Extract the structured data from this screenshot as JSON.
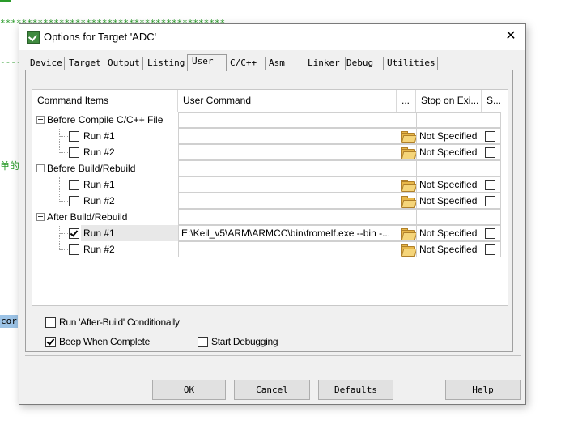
{
  "background": {
    "stars": "******************************************",
    "dashes": "-------",
    "cn_text": "单的",
    "highlight_text": "cor"
  },
  "dialog": {
    "title": "Options for Target 'ADC'",
    "close_glyph": "✕"
  },
  "tabs": [
    {
      "label": "Device"
    },
    {
      "label": "Target"
    },
    {
      "label": "Output"
    },
    {
      "label": "Listing"
    },
    {
      "label": "User"
    },
    {
      "label": "C/C++"
    },
    {
      "label": "Asm"
    },
    {
      "label": "Linker"
    },
    {
      "label": "Debug"
    },
    {
      "label": "Utilities"
    }
  ],
  "active_tab": "User",
  "grid": {
    "headers": {
      "command_items": "Command Items",
      "user_command": "User Command",
      "browse": "...",
      "stop_on_exit": "Stop on Exi...",
      "s": "S..."
    },
    "groups": [
      {
        "label": "Before Compile C/C++ File",
        "runs": [
          {
            "label": "Run #1",
            "checked": false,
            "command": "",
            "stop": "Not Specified",
            "s_checked": false
          },
          {
            "label": "Run #2",
            "checked": false,
            "command": "",
            "stop": "Not Specified",
            "s_checked": false
          }
        ]
      },
      {
        "label": "Before Build/Rebuild",
        "runs": [
          {
            "label": "Run #1",
            "checked": false,
            "command": "",
            "stop": "Not Specified",
            "s_checked": false
          },
          {
            "label": "Run #2",
            "checked": false,
            "command": "",
            "stop": "Not Specified",
            "s_checked": false
          }
        ]
      },
      {
        "label": "After Build/Rebuild",
        "runs": [
          {
            "label": "Run #1",
            "checked": true,
            "command": "E:\\Keil_v5\\ARM\\ARMCC\\bin\\fromelf.exe --bin -...",
            "stop": "Not Specified",
            "s_checked": false
          },
          {
            "label": "Run #2",
            "checked": false,
            "command": "",
            "stop": "Not Specified",
            "s_checked": false
          }
        ]
      }
    ]
  },
  "options": {
    "run_after_build_conditionally": {
      "label": "Run 'After-Build' Conditionally",
      "checked": false
    },
    "beep_when_complete": {
      "label": "Beep When Complete",
      "checked": true
    },
    "start_debugging": {
      "label": "Start Debugging",
      "checked": false
    }
  },
  "buttons": {
    "ok": "OK",
    "cancel": "Cancel",
    "defaults": "Defaults",
    "help": "Help"
  },
  "icons": {
    "browse": "folder-open-icon",
    "expand": "minus-box-icon",
    "logo": "keil-logo-icon"
  }
}
